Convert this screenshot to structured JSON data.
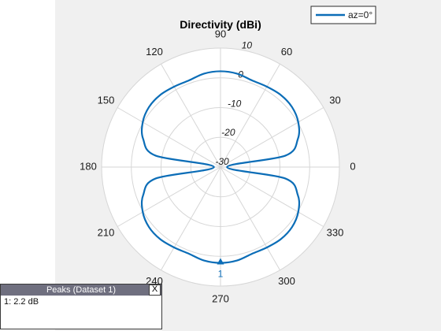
{
  "chart_data": {
    "type": "polar",
    "title": "Directivity (dBi)",
    "angle_ticks": [
      "0",
      "30",
      "60",
      "90",
      "120",
      "150",
      "180",
      "210",
      "240",
      "270",
      "300",
      "330"
    ],
    "angle_tick_degrees": [
      0,
      30,
      60,
      90,
      120,
      150,
      180,
      210,
      240,
      270,
      300,
      330
    ],
    "radial_ticks": [
      "-30",
      "-20",
      "-10",
      "0",
      "10"
    ],
    "radial_tick_values": [
      -30,
      -20,
      -10,
      0,
      10
    ],
    "rlim": [
      -30,
      10
    ],
    "grid": true,
    "legend_position": "top-right",
    "series": [
      {
        "name": "az=0°",
        "color": "#0b6db7",
        "angles_deg": [
          0,
          10,
          20,
          30,
          40,
          50,
          60,
          70,
          80,
          90,
          100,
          110,
          120,
          130,
          140,
          150,
          160,
          170,
          180,
          190,
          200,
          210,
          220,
          230,
          240,
          250,
          260,
          270,
          280,
          290,
          300,
          310,
          320,
          330,
          340,
          350,
          360
        ],
        "values_dB": [
          -27.8,
          -7.8,
          -2.3,
          0.2,
          1.4,
          1.6,
          1.2,
          1.0,
          1.9,
          2.2,
          1.9,
          1.0,
          1.2,
          1.6,
          1.4,
          0.2,
          -2.3,
          -7.8,
          -27.8,
          -7.8,
          -2.3,
          0.2,
          1.4,
          1.6,
          1.2,
          1.0,
          1.9,
          2.2,
          1.9,
          1.0,
          1.2,
          1.6,
          1.4,
          0.2,
          -2.3,
          -7.8,
          -27.8
        ]
      }
    ],
    "markers": [
      {
        "label": "1",
        "angle_deg": 270,
        "value_dB": 2.2
      }
    ]
  },
  "peaks_panel": {
    "title": "Peaks (Dataset 1)",
    "close_label": "X",
    "entries": [
      "1: 2.2 dB"
    ]
  }
}
